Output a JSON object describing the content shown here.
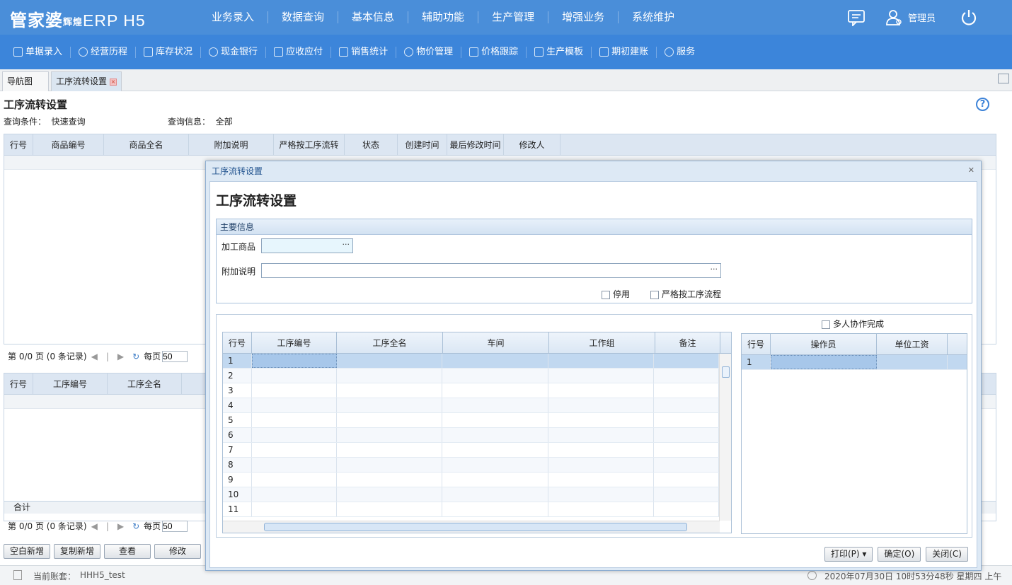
{
  "app": {
    "logo_brand": "管家婆",
    "logo_sub": "辉煌",
    "logo_erp": "ERP H5",
    "user": "管理员"
  },
  "main_nav": [
    "业务录入",
    "数据查询",
    "基本信息",
    "辅助功能",
    "生产管理",
    "增强业务",
    "系统维护"
  ],
  "toolbar": [
    "单据录入",
    "经营历程",
    "库存状况",
    "现金银行",
    "应收应付",
    "销售统计",
    "物价管理",
    "价格跟踪",
    "生产模板",
    "期初建账",
    "服务"
  ],
  "tabs": [
    "导航图",
    "工序流转设置"
  ],
  "page": {
    "title": "工序流转设置",
    "query_label": "查询条件：",
    "query_value": "快速查询",
    "info_label": "查询信息：",
    "info_value": "全部",
    "grid1_headers": [
      "行号",
      "商品编号",
      "商品全名",
      "附加说明",
      "严格按工序流转",
      "状态",
      "创建时间",
      "最后修改时间",
      "修改人"
    ],
    "pager1": {
      "text": "第 0/0 页 (0 条记录)",
      "per_page_label": "每页",
      "per_page": "50"
    },
    "grid2_headers": [
      "行号",
      "工序编号",
      "工序全名"
    ],
    "total_label": "合计",
    "pager2": {
      "text": "第 0/0 页 (0 条记录)",
      "per_page_label": "每页",
      "per_page": "50"
    },
    "buttons": [
      "空白新增",
      "复制新增",
      "查看",
      "修改"
    ]
  },
  "status": {
    "account_label": "当前账套：",
    "account": "HHH5_test",
    "datetime": "2020年07月30日 10时53分48秒 星期四 上午"
  },
  "dialog": {
    "window_title": "工序流转设置",
    "heading": "工序流转设置",
    "section": "主要信息",
    "product_label": "加工商品",
    "note_label": "附加说明",
    "disabled_label": "停用",
    "strict_label": "严格按工序流程",
    "multi_label": "多人协作完成",
    "left_headers": [
      "行号",
      "工序编号",
      "工序全名",
      "车间",
      "工作组",
      "备注"
    ],
    "left_rows": [
      "1",
      "2",
      "3",
      "4",
      "5",
      "6",
      "7",
      "8",
      "9",
      "10",
      "11"
    ],
    "right_headers": [
      "行号",
      "操作员",
      "单位工资"
    ],
    "right_rows": [
      "1"
    ],
    "print_button": "打印(P)",
    "ok_button": "确定(O)",
    "close_button": "关闭(C)"
  }
}
